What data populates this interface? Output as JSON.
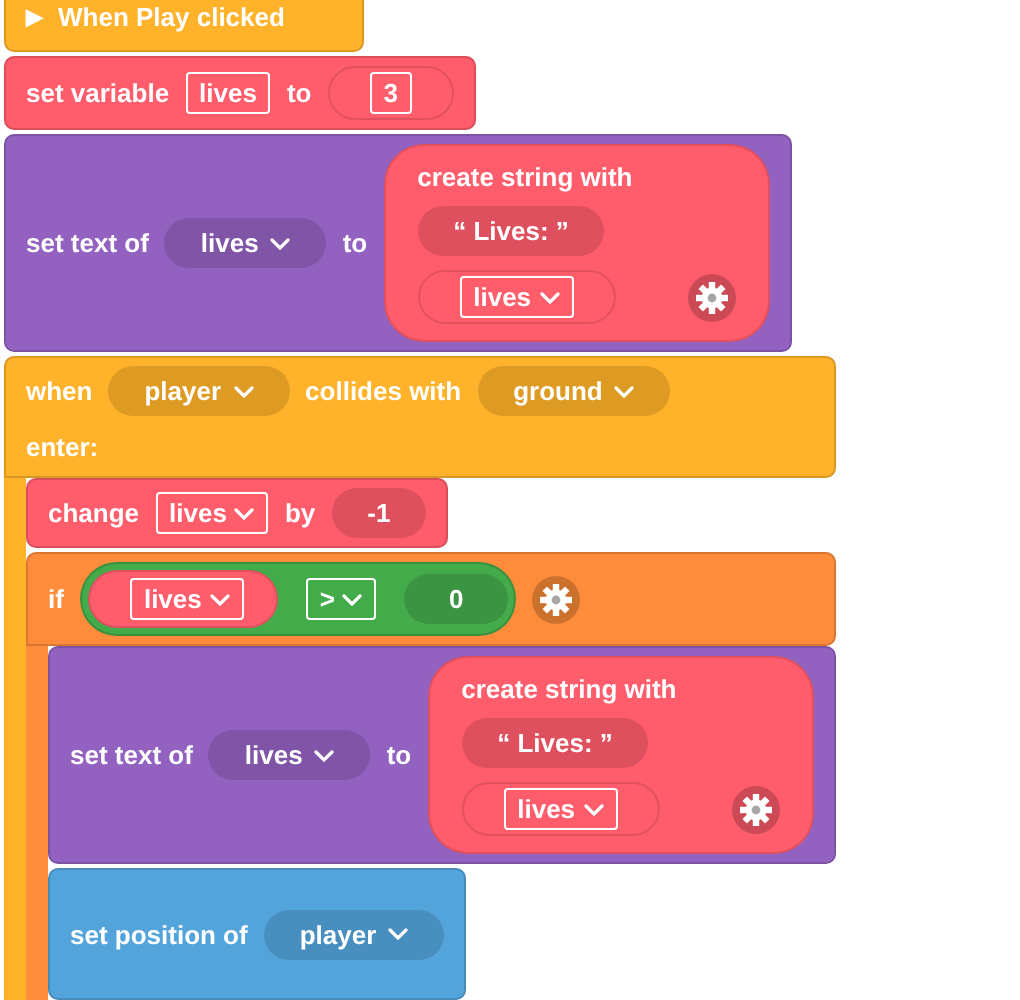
{
  "blocks": [
    {
      "kind": "hat",
      "color": "#ffb22a",
      "rows": [
        [
          {
            "kind": "glyph",
            "text": "▶"
          },
          {
            "kind": "label",
            "text": "When Play clicked"
          }
        ]
      ]
    },
    {
      "kind": "stack",
      "color": "#ff5c6c",
      "rows": [
        [
          {
            "kind": "label",
            "text": "set variable"
          },
          {
            "kind": "field",
            "text": "lives",
            "dropdown": false
          },
          {
            "kind": "label",
            "text": "to"
          },
          {
            "kind": "slot",
            "content": {
              "kind": "field",
              "text": "3",
              "dropdown": false
            }
          }
        ]
      ]
    },
    {
      "kind": "stack",
      "color": "#9362c0",
      "rows": [
        [
          {
            "kind": "label",
            "text": "set text of"
          },
          {
            "kind": "pill",
            "text": "lives",
            "dropdown": true
          },
          {
            "kind": "label",
            "text": "to"
          },
          {
            "kind": "join",
            "color": "#ff5c6c",
            "title": "create string with",
            "rows": [
              [
                {
                  "kind": "pill",
                  "text": "“  Lives:  ”",
                  "dropdown": false
                }
              ],
              [
                {
                  "kind": "slot",
                  "content": {
                    "kind": "field",
                    "text": "lives",
                    "dropdown": true
                  }
                },
                {
                  "kind": "gear"
                }
              ]
            ]
          }
        ]
      ]
    },
    {
      "kind": "container",
      "color": "#ffb22a",
      "rows": [
        [
          {
            "kind": "label",
            "text": "when"
          },
          {
            "kind": "pill",
            "text": "player",
            "dropdown": true
          },
          {
            "kind": "label",
            "text": "collides with"
          },
          {
            "kind": "pill",
            "text": "ground",
            "dropdown": true
          }
        ],
        [
          {
            "kind": "label",
            "text": "enter:"
          }
        ]
      ],
      "children": [
        {
          "kind": "stack",
          "color": "#ff5c6c",
          "rows": [
            [
              {
                "kind": "label",
                "text": "change"
              },
              {
                "kind": "field",
                "text": "lives",
                "dropdown": true
              },
              {
                "kind": "label",
                "text": "by"
              },
              {
                "kind": "pill",
                "text": "-1",
                "dropdown": false
              }
            ]
          ]
        },
        {
          "kind": "container",
          "color": "#ff8c3a",
          "rows": [
            [
              {
                "kind": "label",
                "text": "if"
              },
              {
                "kind": "compare",
                "color": "#44ab4b",
                "items": [
                  {
                    "kind": "reporter",
                    "color": "#ff5c6c",
                    "content": {
                      "kind": "field",
                      "text": "lives",
                      "dropdown": true
                    }
                  },
                  {
                    "kind": "field",
                    "text": ">",
                    "dropdown": true
                  },
                  {
                    "kind": "pill",
                    "text": "0",
                    "dropdown": false
                  }
                ]
              },
              {
                "kind": "gear"
              }
            ]
          ],
          "children": [
            {
              "kind": "stack",
              "color": "#9362c0",
              "rows": [
                [
                  {
                    "kind": "label",
                    "text": "set text of"
                  },
                  {
                    "kind": "pill",
                    "text": "lives",
                    "dropdown": true
                  },
                  {
                    "kind": "label",
                    "text": "to"
                  },
                  {
                    "kind": "join",
                    "color": "#ff5c6c",
                    "title": "create string with",
                    "rows": [
                      [
                        {
                          "kind": "pill",
                          "text": "“  Lives:  ”",
                          "dropdown": false
                        }
                      ],
                      [
                        {
                          "kind": "slot",
                          "content": {
                            "kind": "field",
                            "text": "lives",
                            "dropdown": true
                          }
                        },
                        {
                          "kind": "gear"
                        }
                      ]
                    ]
                  }
                ]
              ]
            },
            {
              "kind": "stack",
              "color": "#53a4db",
              "rows": [
                [
                  {
                    "kind": "label",
                    "text": "set position of"
                  },
                  {
                    "kind": "pill",
                    "text": "player",
                    "dropdown": true
                  }
                ]
              ]
            }
          ]
        }
      ]
    }
  ]
}
